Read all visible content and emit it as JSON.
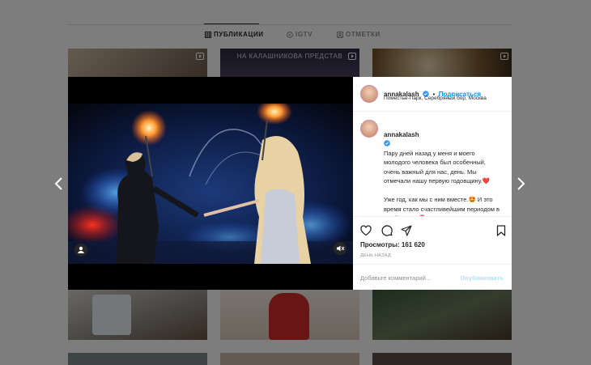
{
  "tabs": [
    {
      "label": "ПУБЛИКАЦИИ",
      "icon": "grid-icon"
    },
    {
      "label": "IGTV",
      "icon": "igtv-icon"
    },
    {
      "label": "ОТМЕТКИ",
      "icon": "tag-icon"
    }
  ],
  "grid_banner_text": "НА КАЛАШНИКОВА ПРЕДСТАВ",
  "post": {
    "username": "annakalash",
    "follow_label": "Подписаться",
    "separator": "•",
    "location": "Поместье-Парк, Серебряный бор, Москва",
    "caption_user": "annakalash",
    "caption": "Пару дней назад у меня и моего молодого человека был особенный, очень важный для нас, день. Мы отмечали нашу первую годовщину.❤️\n\nУже год, как мы с ним вместе.🤩 И это время стало счастливейшим периодом в моей жизни.💏\nЯ бесконечно благодарна ему за нежность, поддержку, дружбу и",
    "views_label": "Просмотры: 161 620",
    "time_ago": "ДЕНЬ НАЗАД",
    "comment_placeholder": "Добавьте комментарий...",
    "publish_label": "Опубликовать"
  },
  "colors": {
    "accent": "#0095f6",
    "publish_disabled": "#b2dffc",
    "verified": "#3897f0"
  }
}
